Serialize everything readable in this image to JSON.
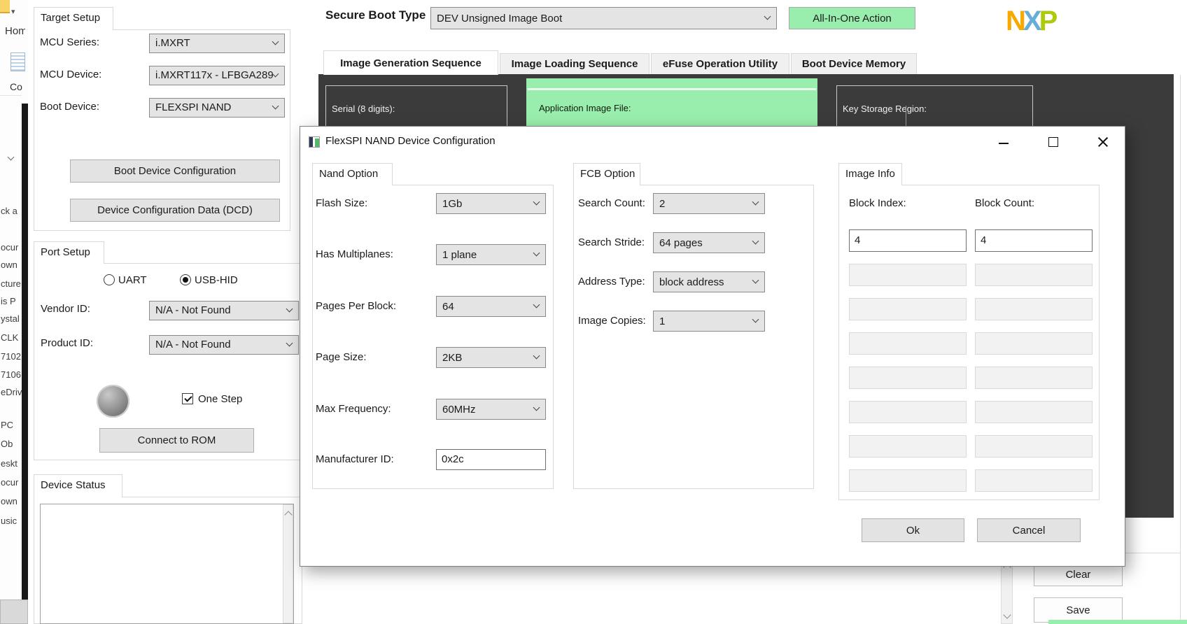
{
  "colors": {
    "accent_green": "#99eead",
    "panel_dark": "#3b3b3b",
    "nxp_orange": "#f8a900",
    "nxp_blue": "#64aed9",
    "nxp_green": "#afca0b"
  },
  "explorer": {
    "ribbon": {
      "home_tab": "Hom",
      "copy_label": "Co"
    },
    "nav_items": [
      "ck a",
      "ocur",
      "own",
      "cture",
      "is P",
      "ystal",
      "CLK",
      "7102",
      "7106",
      "eDriv",
      "PC",
      "Ob",
      "eskt",
      "ocur",
      "own",
      "usic"
    ]
  },
  "app": {
    "secure_boot": {
      "label": "Secure Boot Type",
      "value": "DEV Unsigned Image Boot",
      "action_button": "All-In-One Action"
    },
    "logo": {
      "n": "N",
      "x": "X",
      "p": "P"
    },
    "tabs": [
      {
        "label": "Image Generation Sequence",
        "active": true
      },
      {
        "label": "Image Loading Sequence",
        "active": false
      },
      {
        "label": "eFuse Operation Utility",
        "active": false
      },
      {
        "label": "Boot Device Memory",
        "active": false
      }
    ],
    "panel": {
      "serial_label": "Serial (8 digits):",
      "app_image_label": "Application Image File:",
      "key_storage_label": "Key Storage Region:"
    },
    "target_setup": {
      "title": "Target Setup",
      "fields": [
        {
          "label": "MCU Series:",
          "value": "i.MXRT"
        },
        {
          "label": "MCU Device:",
          "value": "i.MXRT117x - LFBGA289"
        },
        {
          "label": "Boot Device:",
          "value": "FLEXSPI NAND"
        }
      ],
      "buttons": [
        "Boot Device Configuration",
        "Device Configuration Data (DCD)"
      ]
    },
    "port_setup": {
      "title": "Port Setup",
      "radios": [
        {
          "label": "UART",
          "selected": false
        },
        {
          "label": "USB-HID",
          "selected": true
        }
      ],
      "fields": [
        {
          "label": "Vendor ID:",
          "value": "N/A - Not Found"
        },
        {
          "label": "Product ID:",
          "value": "N/A - Not Found"
        }
      ],
      "one_step": {
        "label": "One Step",
        "checked": true
      },
      "connect_button": "Connect to ROM"
    },
    "device_status": {
      "title": "Device Status"
    },
    "log": {
      "clear_button": "Clear",
      "save_button": "Save"
    }
  },
  "dialog": {
    "title": "FlexSPI NAND Device Configuration",
    "nand_option": {
      "title": "Nand Option",
      "fields": [
        {
          "label": "Flash Size:",
          "value": "1Gb",
          "type": "combo"
        },
        {
          "label": "Has Multiplanes:",
          "value": "1 plane",
          "type": "combo"
        },
        {
          "label": "Pages Per Block:",
          "value": "64",
          "type": "combo"
        },
        {
          "label": "Page Size:",
          "value": "2KB",
          "type": "combo"
        },
        {
          "label": "Max Frequency:",
          "value": "60MHz",
          "type": "combo"
        },
        {
          "label": "Manufacturer ID:",
          "value": "0x2c",
          "type": "input"
        }
      ]
    },
    "fcb_option": {
      "title": "FCB Option",
      "fields": [
        {
          "label": "Search Count:",
          "value": "2"
        },
        {
          "label": "Search Stride:",
          "value": "64 pages"
        },
        {
          "label": "Address Type:",
          "value": "block address"
        },
        {
          "label": "Image Copies:",
          "value": "1"
        }
      ]
    },
    "image_info": {
      "title": "Image Info",
      "col1_header": "Block Index:",
      "col2_header": "Block Count:",
      "rows": [
        {
          "index": "4",
          "count": "4",
          "enabled": true
        },
        {
          "index": "",
          "count": "",
          "enabled": false
        },
        {
          "index": "",
          "count": "",
          "enabled": false
        },
        {
          "index": "",
          "count": "",
          "enabled": false
        },
        {
          "index": "",
          "count": "",
          "enabled": false
        },
        {
          "index": "",
          "count": "",
          "enabled": false
        },
        {
          "index": "",
          "count": "",
          "enabled": false
        },
        {
          "index": "",
          "count": "",
          "enabled": false
        }
      ]
    },
    "ok_button": "Ok",
    "cancel_button": "Cancel"
  }
}
